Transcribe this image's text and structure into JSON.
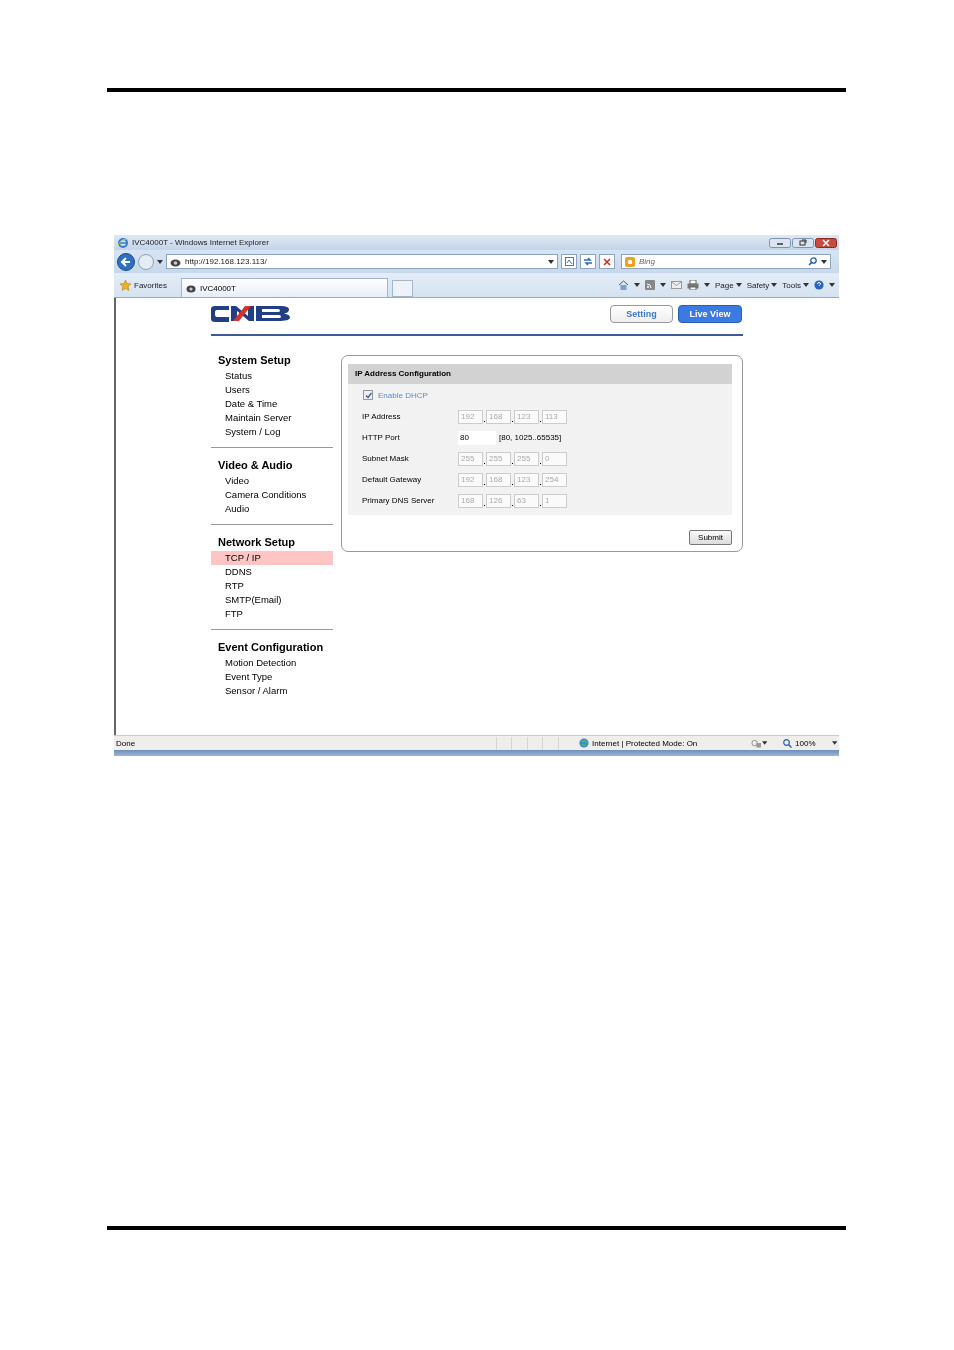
{
  "window": {
    "title": "IVC4000T - Windows Internet Explorer"
  },
  "address_bar": {
    "url": "http://192.168.123.113/"
  },
  "search": {
    "placeholder": "Bing"
  },
  "favorites_bar": {
    "favorites": "Favorites",
    "tabs": [
      {
        "label": "IVC4000T",
        "selected": true
      }
    ],
    "commands": [
      "Page",
      "Safety",
      "Tools"
    ]
  },
  "header": {
    "buttons": [
      {
        "label": "Setting",
        "kind": "outline"
      },
      {
        "label": "Live View",
        "kind": "filled"
      }
    ]
  },
  "sidebar": {
    "sections": [
      {
        "title": "System Setup",
        "items": [
          {
            "label": "Status",
            "selected": false
          },
          {
            "label": "Users",
            "selected": false
          },
          {
            "label": "Date & Time",
            "selected": false
          },
          {
            "label": "Maintain Server",
            "selected": false
          },
          {
            "label": "System / Log",
            "selected": false
          }
        ]
      },
      {
        "title": "Video & Audio",
        "items": [
          {
            "label": "Video",
            "selected": false
          },
          {
            "label": "Camera Conditions",
            "selected": false
          },
          {
            "label": "Audio",
            "selected": false
          }
        ]
      },
      {
        "title": "Network Setup",
        "items": [
          {
            "label": "TCP / IP",
            "selected": true
          },
          {
            "label": "DDNS",
            "selected": false
          },
          {
            "label": "RTP",
            "selected": false
          },
          {
            "label": "SMTP(Email)",
            "selected": false
          },
          {
            "label": "FTP",
            "selected": false
          }
        ]
      },
      {
        "title": "Event Configuration",
        "items": [
          {
            "label": "Motion Detection",
            "selected": false
          },
          {
            "label": "Event Type",
            "selected": false
          },
          {
            "label": "Sensor / Alarm",
            "selected": false
          }
        ]
      }
    ]
  },
  "panel": {
    "title": "IP Address Configuration",
    "dhcp": {
      "label": "Enable DHCP",
      "checked": true,
      "disabled": true
    },
    "fields": [
      {
        "label": "IP Address",
        "kind": "ip",
        "octets": [
          "192",
          "168",
          "123",
          "113"
        ],
        "disabled": true
      },
      {
        "label": "HTTP Port",
        "kind": "port",
        "value": "80",
        "hint": "[80, 1025..65535]"
      },
      {
        "label": "Subnet Mask",
        "kind": "ip",
        "octets": [
          "255",
          "255",
          "255",
          "0"
        ],
        "disabled": true
      },
      {
        "label": "Default Gateway",
        "kind": "ip",
        "octets": [
          "192",
          "168",
          "123",
          "254"
        ],
        "disabled": true
      },
      {
        "label": "Primary DNS Server",
        "kind": "ip",
        "octets": [
          "168",
          "126",
          "63",
          "1"
        ],
        "disabled": true
      }
    ],
    "submit": "Submit"
  },
  "status_bar": {
    "text": "Done",
    "zone": "Internet | Protected Mode: On",
    "zoom": "100%"
  }
}
